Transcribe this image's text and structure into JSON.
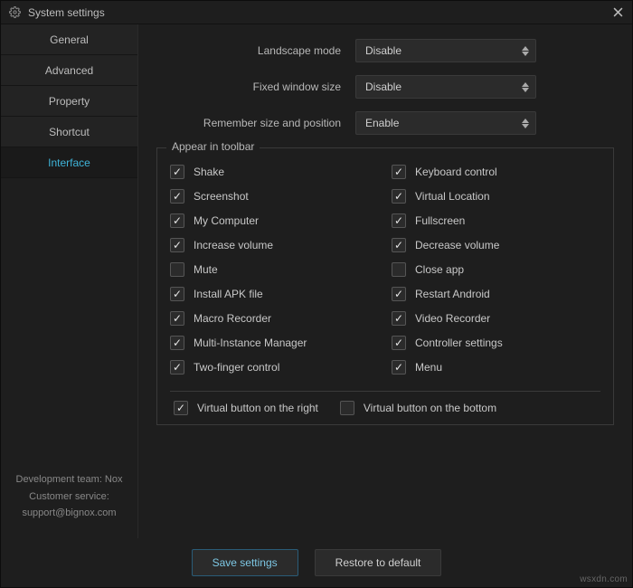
{
  "titlebar": {
    "title": "System settings"
  },
  "sidebar": {
    "tabs": [
      {
        "label": "General"
      },
      {
        "label": "Advanced"
      },
      {
        "label": "Property"
      },
      {
        "label": "Shortcut"
      },
      {
        "label": "Interface"
      }
    ],
    "active_index": 4,
    "footer": {
      "line1": "Development team: Nox",
      "line2": "Customer service:",
      "line3": "support@bignox.com"
    }
  },
  "settings": {
    "landscape_mode": {
      "label": "Landscape mode",
      "value": "Disable"
    },
    "fixed_window_size": {
      "label": "Fixed window size",
      "value": "Disable"
    },
    "remember_size": {
      "label": "Remember size and position",
      "value": "Enable"
    }
  },
  "toolbar": {
    "legend": "Appear in toolbar",
    "items": [
      {
        "label": "Shake",
        "checked": true
      },
      {
        "label": "Keyboard control",
        "checked": true
      },
      {
        "label": "Screenshot",
        "checked": true
      },
      {
        "label": "Virtual Location",
        "checked": true
      },
      {
        "label": "My Computer",
        "checked": true
      },
      {
        "label": "Fullscreen",
        "checked": true
      },
      {
        "label": "Increase volume",
        "checked": true
      },
      {
        "label": "Decrease volume",
        "checked": true
      },
      {
        "label": "Mute",
        "checked": false
      },
      {
        "label": "Close app",
        "checked": false
      },
      {
        "label": "Install APK file",
        "checked": true
      },
      {
        "label": "Restart Android",
        "checked": true
      },
      {
        "label": "Macro Recorder",
        "checked": true
      },
      {
        "label": "Video Recorder",
        "checked": true
      },
      {
        "label": "Multi-Instance Manager",
        "checked": true
      },
      {
        "label": "Controller settings",
        "checked": true
      },
      {
        "label": "Two-finger control",
        "checked": true
      },
      {
        "label": "Menu",
        "checked": true
      }
    ],
    "virtual_right": {
      "label": "Virtual button on the right",
      "checked": true
    },
    "virtual_bottom": {
      "label": "Virtual button on the bottom",
      "checked": false
    }
  },
  "footer": {
    "save": "Save settings",
    "restore": "Restore to default"
  },
  "watermark": "wsxdn.com"
}
